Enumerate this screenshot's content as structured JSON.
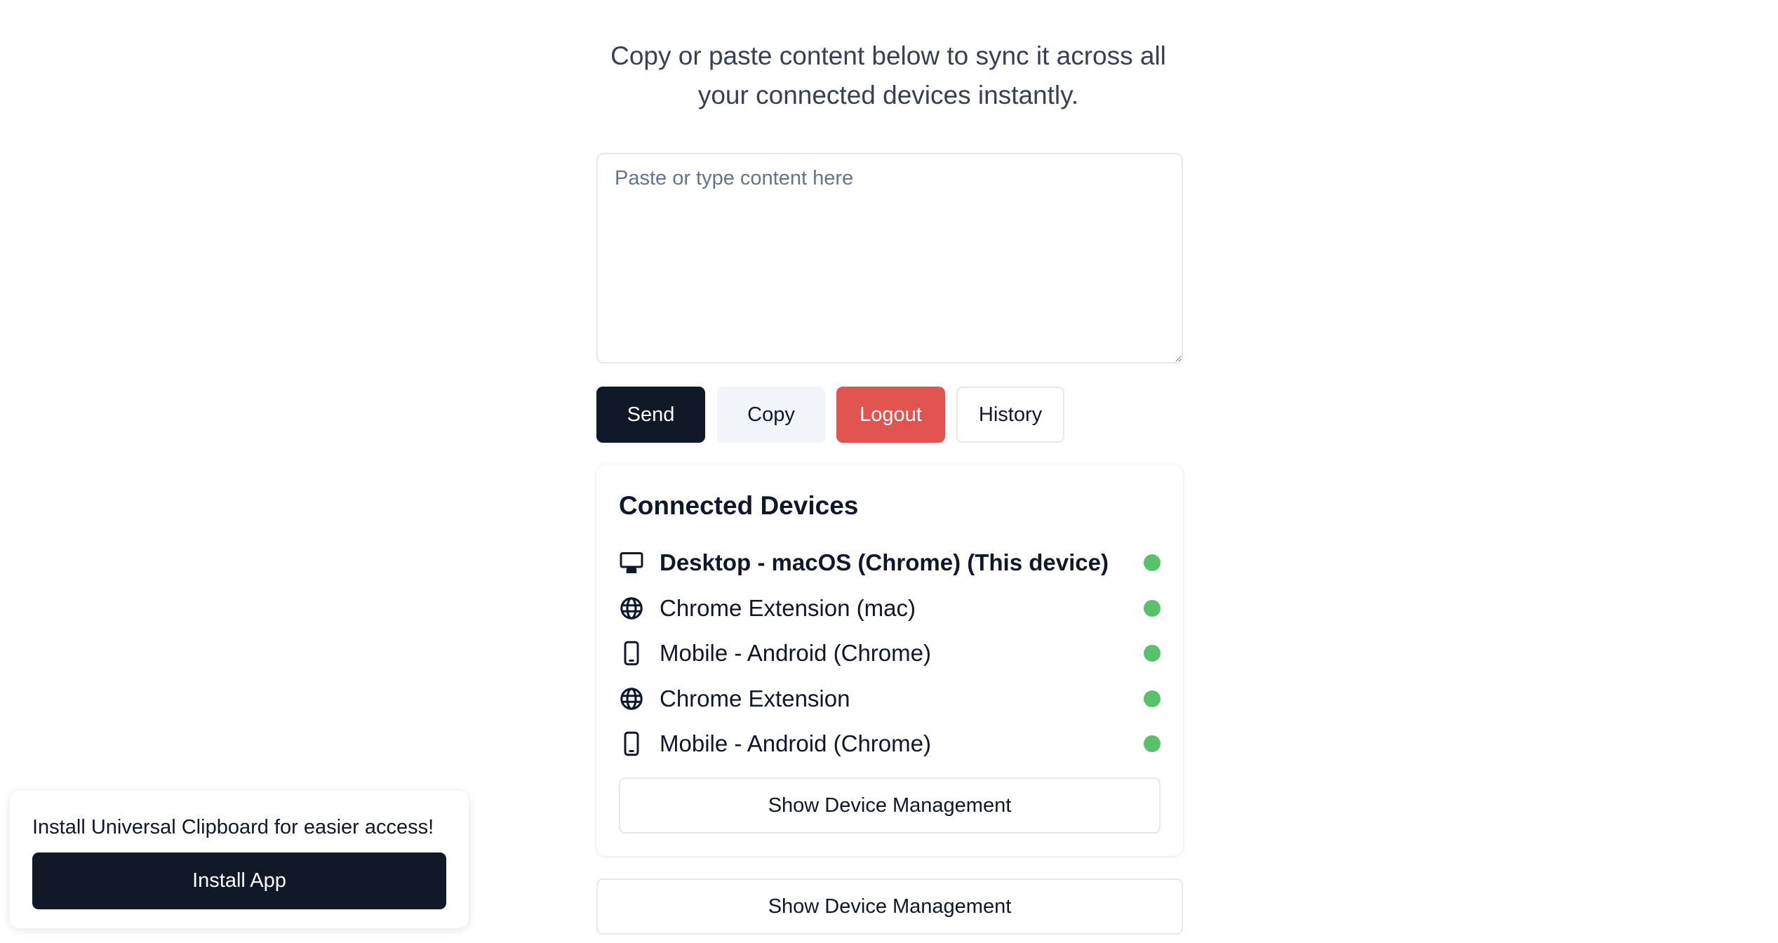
{
  "intro": {
    "line1": "Copy or paste content below to sync it across all",
    "line2": "your connected devices instantly."
  },
  "input": {
    "placeholder": "Paste or type content here",
    "value": ""
  },
  "actions": {
    "send_label": "Send",
    "copy_label": "Copy",
    "logout_label": "Logout",
    "history_label": "History"
  },
  "devices": {
    "title": "Connected Devices",
    "items": [
      {
        "label": "Desktop - macOS (Chrome) (This device)",
        "icon": "desktop-icon",
        "status": "online",
        "current": true
      },
      {
        "label": "Chrome Extension (mac)",
        "icon": "globe-icon",
        "status": "online",
        "current": false
      },
      {
        "label": "Mobile - Android (Chrome)",
        "icon": "mobile-phone-icon",
        "status": "online",
        "current": false
      },
      {
        "label": "Chrome Extension",
        "icon": "globe-icon",
        "status": "online",
        "current": false
      },
      {
        "label": "Mobile - Android (Chrome)",
        "icon": "mobile-phone-icon",
        "status": "online",
        "current": false
      }
    ],
    "manage_label": "Show Device Management"
  },
  "outer_manage_label": "Show Device Management",
  "install": {
    "message": "Install Universal Clipboard for easier access!",
    "button_label": "Install App"
  },
  "colors": {
    "primary_dark": "#111827",
    "danger": "#e0534f",
    "muted_bg": "#f1f5f9",
    "status_online": "#57c26a",
    "border": "#e2e8f0"
  }
}
